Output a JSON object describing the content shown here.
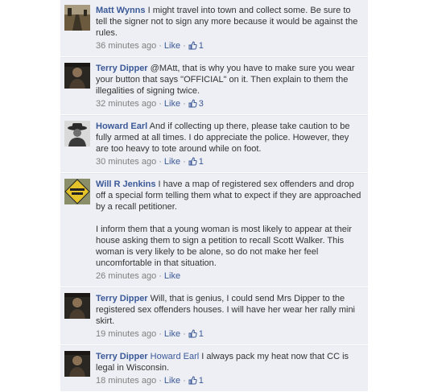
{
  "comments": [
    {
      "author": "Matt Wynns",
      "mention": "",
      "text": "I might travel into town and collect some. Be sure to tell the signer not to sign any more because it would be against the rules.",
      "time": "36 minutes ago",
      "like_label": "Like",
      "like_count": "1",
      "avatar_icon": "road-photo-icon"
    },
    {
      "author": "Terry Dipper",
      "mention": "",
      "text": "@MAtt, that is why you have to make sure you wear your button that says \"OFFICIAL\" on it. Then explain to them the illegalities of signing twice.",
      "time": "32 minutes ago",
      "like_label": "Like",
      "like_count": "3",
      "avatar_icon": "person-photo-icon"
    },
    {
      "author": "Howard Earl",
      "mention": "",
      "text": "And if collecting up there, please take caution to be fully armed at all times. I do appreciate the police. However, they are too heavy to tote around while on foot.",
      "time": "30 minutes ago",
      "like_label": "Like",
      "like_count": "1",
      "avatar_icon": "hat-person-photo-icon"
    },
    {
      "author": "Will R Jenkins",
      "mention": "",
      "text": "I have a map of registered sex offenders and drop off a special form telling them what to expect if they are approached by a recall petitioner.\n\nI inform them that a young woman is most likely to appear at their house asking them to sign a petition to recall Scott Walker. This woman is very likely to be alone, so do not make her feel uncomfortable in that situation.",
      "time": "26 minutes ago",
      "like_label": "Like",
      "like_count": "",
      "avatar_icon": "road-sign-icon"
    },
    {
      "author": "Terry Dipper",
      "mention": "",
      "text": "Will, that is genius, I could send Mrs Dipper to the registered sex offenders houses. I will have her wear her rally mini skirt.",
      "time": "19 minutes ago",
      "like_label": "Like",
      "like_count": "1",
      "avatar_icon": "person-photo-icon"
    },
    {
      "author": "Terry Dipper",
      "mention": "Howard Earl",
      "text": "I always pack my heat now that CC is legal in Wisconsin.",
      "time": "18 minutes ago",
      "like_label": "Like",
      "like_count": "1",
      "avatar_icon": "person-photo-icon"
    }
  ],
  "separator": "·",
  "colors": {
    "comment_bg": "#edeff4",
    "link": "#3b5998",
    "meta": "#808080",
    "text": "#333333"
  }
}
